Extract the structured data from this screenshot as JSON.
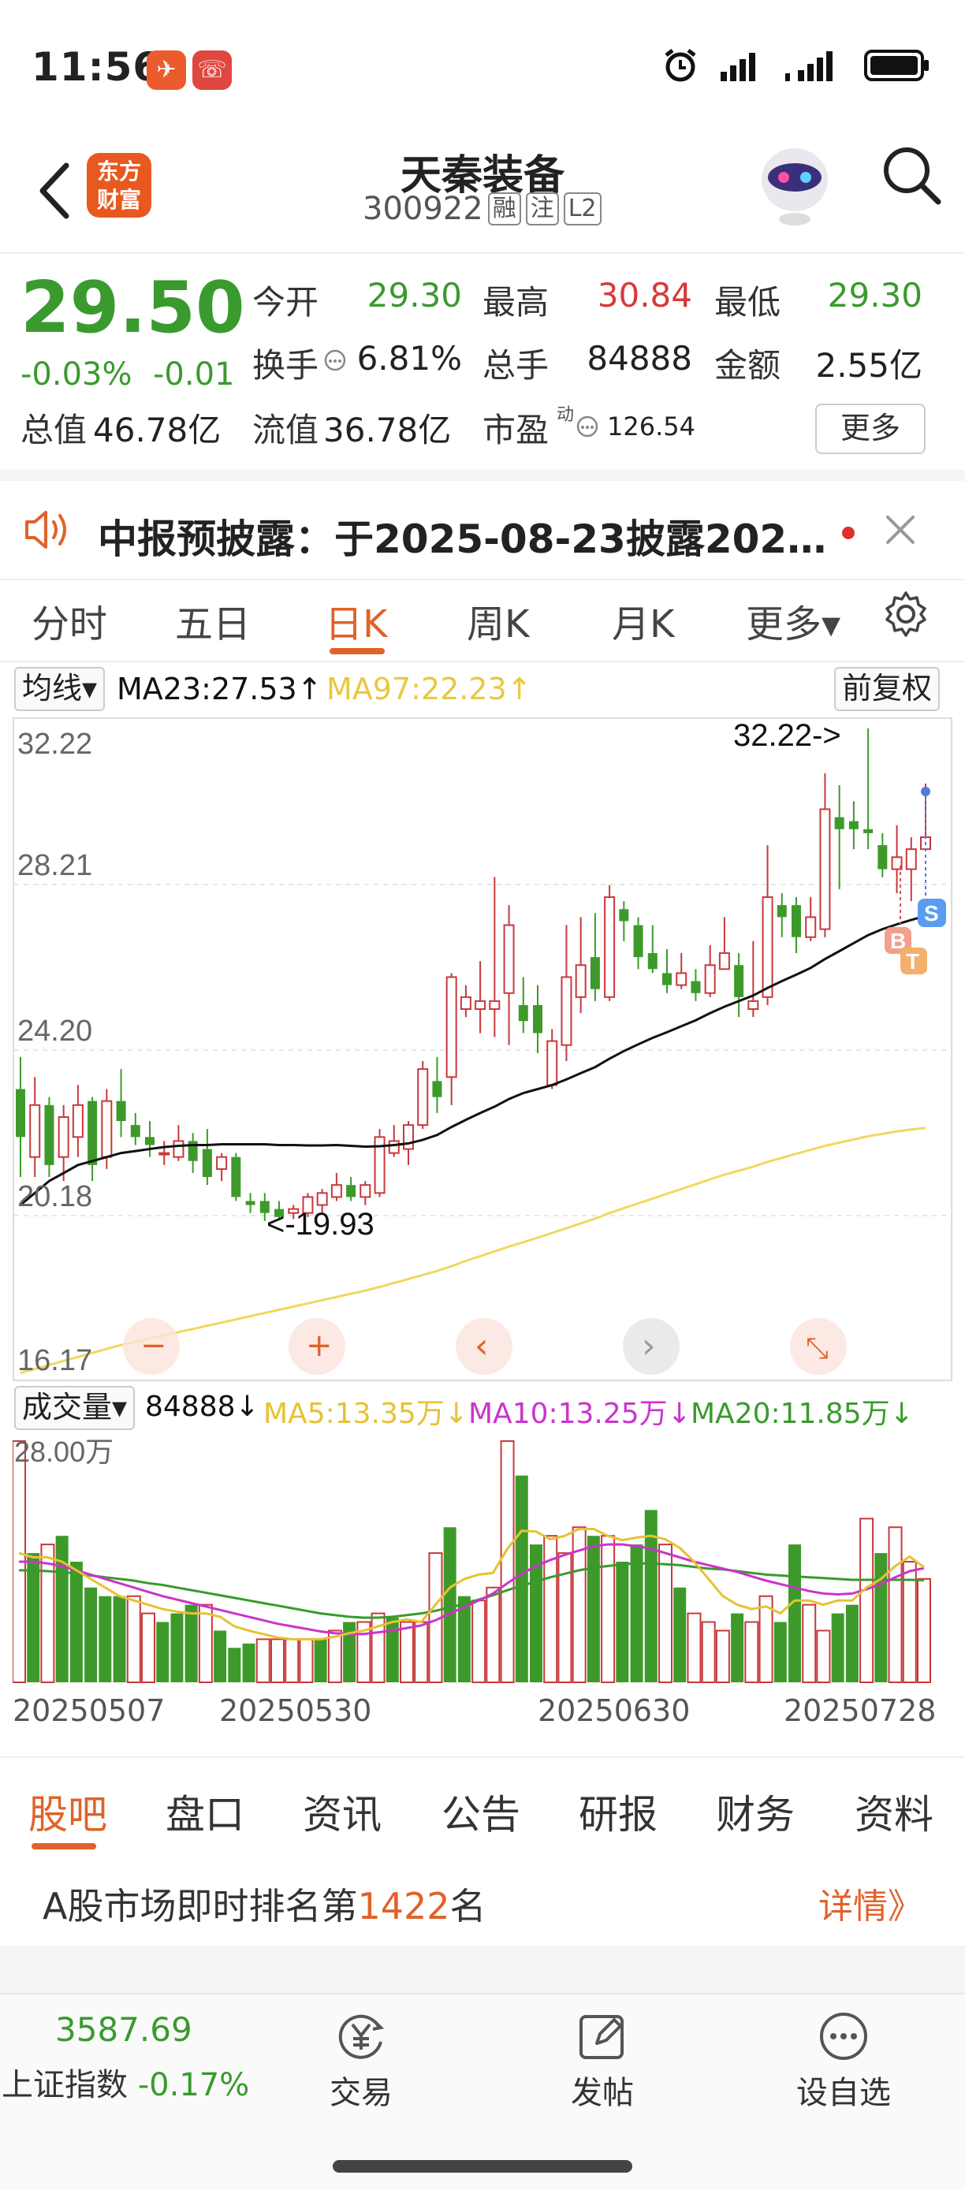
{
  "status_bar": {
    "time": "11:56",
    "app_badge_1": "✈",
    "app_badge_2": "☏"
  },
  "header": {
    "brand_line1": "东方",
    "brand_line2": "财富",
    "stock_name": "天秦装备",
    "stock_code": "300922",
    "tags": [
      "融",
      "注",
      "L2"
    ]
  },
  "quote": {
    "price": "29.50",
    "change_pct": "-0.03%",
    "change_amt": "-0.01",
    "open_label": "今开",
    "open": "29.30",
    "high_label": "最高",
    "high": "30.84",
    "low_label": "最低",
    "low": "29.30",
    "turnover_label": "换手",
    "turnover": "6.81%",
    "volume_label": "总手",
    "volume": "84888",
    "amount_label": "金额",
    "amount": "2.55亿",
    "mktcap_label": "总值",
    "mktcap": "46.78亿",
    "float_label": "流值",
    "float_cap": "36.78亿",
    "pe_label": "市盈",
    "pe_sup": "动",
    "pe": "126.54",
    "more": "更多"
  },
  "notice": {
    "text": "中报预披露：于2025-08-23披露202…"
  },
  "kline_tabs": {
    "items": [
      "分时",
      "五日",
      "日K",
      "周K",
      "月K",
      "更多▾"
    ],
    "active": "日K"
  },
  "ma_row": {
    "selector": "均线▾",
    "ma23": "MA23:27.53↑",
    "ma97": "MA97:22.23↑",
    "adjust": "前复权"
  },
  "chart_data": {
    "type": "candlestick",
    "y_axis_labels": [
      "32.22",
      "28.21",
      "24.20",
      "20.18",
      "16.17"
    ],
    "ylim": [
      16.17,
      32.22
    ],
    "max_label": "32.22->",
    "min_label": "<-19.93",
    "markers": [
      "B",
      "T",
      "S"
    ],
    "candles": [
      [
        23.2,
        22.0,
        24.0,
        21.0
      ],
      [
        21.5,
        22.8,
        23.5,
        21.0
      ],
      [
        22.8,
        21.3,
        23.0,
        21.0
      ],
      [
        21.5,
        22.5,
        22.8,
        20.9
      ],
      [
        22.0,
        22.8,
        23.3,
        21.5
      ],
      [
        22.9,
        21.3,
        23.0,
        20.9
      ],
      [
        21.5,
        22.9,
        23.2,
        21.2
      ],
      [
        22.9,
        22.4,
        23.7,
        22.0
      ],
      [
        22.3,
        22.0,
        22.6,
        21.8
      ],
      [
        22.0,
        21.8,
        22.4,
        21.5
      ],
      [
        21.6,
        21.6,
        21.9,
        21.3
      ],
      [
        21.5,
        21.9,
        22.3,
        21.4
      ],
      [
        21.9,
        21.4,
        22.1,
        21.1
      ],
      [
        21.7,
        21.0,
        22.2,
        20.8
      ],
      [
        21.2,
        21.5,
        21.6,
        20.9
      ],
      [
        21.5,
        20.5,
        21.6,
        20.4
      ],
      [
        20.4,
        20.3,
        20.6,
        20.1
      ],
      [
        20.4,
        20.1,
        20.6,
        19.9
      ],
      [
        20.2,
        20.0,
        20.4,
        19.93
      ],
      [
        20.1,
        20.2,
        20.3,
        19.95
      ],
      [
        20.1,
        20.5,
        20.6,
        20.0
      ],
      [
        20.3,
        20.6,
        20.7,
        20.1
      ],
      [
        20.5,
        20.8,
        21.1,
        20.4
      ],
      [
        20.8,
        20.5,
        21.0,
        20.4
      ],
      [
        20.5,
        20.8,
        20.9,
        20.3
      ],
      [
        20.6,
        22.0,
        22.2,
        20.5
      ],
      [
        21.6,
        21.9,
        22.3,
        21.5
      ],
      [
        21.7,
        22.3,
        22.4,
        21.3
      ],
      [
        22.3,
        23.7,
        23.9,
        22.2
      ],
      [
        23.4,
        23.0,
        24.0,
        22.6
      ],
      [
        23.5,
        26.0,
        26.1,
        22.8
      ],
      [
        25.2,
        25.5,
        25.8,
        25.0
      ],
      [
        25.2,
        25.4,
        26.4,
        24.6
      ],
      [
        25.2,
        25.4,
        28.5,
        24.5
      ],
      [
        25.6,
        27.3,
        27.8,
        24.3
      ],
      [
        25.3,
        24.9,
        26.0,
        24.6
      ],
      [
        25.3,
        24.6,
        25.8,
        24.1
      ],
      [
        23.3,
        24.4,
        24.7,
        23.2
      ],
      [
        24.3,
        26.0,
        27.3,
        23.9
      ],
      [
        25.5,
        26.3,
        27.5,
        25.1
      ],
      [
        26.5,
        25.7,
        27.6,
        25.4
      ],
      [
        25.5,
        28.0,
        28.3,
        25.4
      ],
      [
        27.7,
        27.4,
        27.9,
        26.9
      ],
      [
        27.3,
        26.5,
        27.5,
        26.2
      ],
      [
        26.6,
        26.2,
        27.3,
        26.1
      ],
      [
        26.1,
        25.8,
        26.7,
        25.6
      ],
      [
        25.8,
        26.1,
        26.6,
        25.7
      ],
      [
        25.9,
        25.6,
        26.2,
        25.4
      ],
      [
        25.6,
        26.3,
        26.8,
        25.5
      ],
      [
        26.2,
        26.6,
        27.5,
        26.2
      ],
      [
        26.3,
        25.5,
        26.6,
        25.0
      ],
      [
        25.2,
        25.4,
        26.9,
        25.0
      ],
      [
        25.5,
        28.0,
        29.3,
        25.3
      ],
      [
        27.8,
        27.5,
        28.1,
        27.0
      ],
      [
        27.8,
        27.0,
        28.0,
        26.6
      ],
      [
        27.0,
        27.5,
        28.0,
        26.9
      ],
      [
        27.2,
        30.2,
        31.1,
        27.0
      ],
      [
        30.0,
        29.7,
        30.8,
        28.2
      ],
      [
        29.9,
        29.7,
        30.4,
        29.2
      ],
      [
        29.7,
        29.6,
        32.22,
        29.2
      ],
      [
        29.3,
        28.7,
        29.6,
        28.5
      ],
      [
        28.7,
        29.0,
        29.8,
        28.1
      ],
      [
        28.7,
        29.2,
        29.5,
        27.9
      ],
      [
        29.2,
        29.5,
        30.84,
        29.3
      ]
    ],
    "ma23": [
      20.3,
      20.6,
      20.9,
      21.1,
      21.3,
      21.4,
      21.5,
      21.6,
      21.65,
      21.7,
      21.75,
      21.78,
      21.8,
      21.8,
      21.82,
      21.82,
      21.82,
      21.82,
      21.8,
      21.8,
      21.79,
      21.79,
      21.8,
      21.78,
      21.76,
      21.77,
      21.8,
      21.84,
      21.93,
      22.05,
      22.25,
      22.43,
      22.6,
      22.76,
      22.95,
      23.1,
      23.2,
      23.3,
      23.44,
      23.6,
      23.75,
      23.96,
      24.15,
      24.32,
      24.48,
      24.62,
      24.77,
      24.92,
      25.1,
      25.26,
      25.4,
      25.54,
      25.73,
      25.9,
      26.06,
      26.23,
      26.45,
      26.65,
      26.85,
      27.05,
      27.2,
      27.32,
      27.43,
      27.53
    ],
    "ma97": [
      16.1,
      16.2,
      16.3,
      16.4,
      16.5,
      16.6,
      16.7,
      16.8,
      16.88,
      16.96,
      17.04,
      17.12,
      17.2,
      17.28,
      17.36,
      17.44,
      17.52,
      17.6,
      17.68,
      17.76,
      17.84,
      17.92,
      18.0,
      18.08,
      18.16,
      18.25,
      18.35,
      18.45,
      18.55,
      18.65,
      18.77,
      18.9,
      19.02,
      19.14,
      19.26,
      19.37,
      19.48,
      19.6,
      19.72,
      19.84,
      19.96,
      20.1,
      20.22,
      20.34,
      20.46,
      20.58,
      20.7,
      20.82,
      20.94,
      21.06,
      21.16,
      21.26,
      21.38,
      21.48,
      21.58,
      21.68,
      21.78,
      21.86,
      21.94,
      22.02,
      22.08,
      22.14,
      22.19,
      22.23
    ]
  },
  "chart_controls": [
    "−",
    "+",
    "‹",
    "›",
    "⤡"
  ],
  "vol_row": {
    "selector": "成交量▾",
    "vol": "84888↓",
    "ma5": "MA5:13.35万↓",
    "ma10": "MA10:13.25万↓",
    "ma20": "MA20:11.85万↓",
    "scale": "28.00万"
  },
  "volume_data": {
    "values": [
      28,
      15,
      16,
      17,
      14,
      11,
      10,
      10,
      10,
      8,
      7,
      8,
      9,
      9,
      6,
      4,
      4.5,
      5,
      5,
      5,
      5,
      5,
      6,
      7,
      7,
      8,
      7.5,
      7,
      7,
      15,
      18,
      10,
      9.5,
      11,
      28,
      24,
      16,
      17,
      15,
      18,
      17,
      17,
      14,
      16,
      20,
      16,
      11,
      8,
      7,
      6,
      8,
      7,
      10,
      7,
      16,
      9,
      6,
      8,
      9,
      19,
      15,
      18,
      14,
      12
    ],
    "up": [
      1,
      0,
      1,
      0,
      0,
      0,
      0,
      0,
      1,
      1,
      0,
      0,
      0,
      1,
      0,
      0,
      0,
      1,
      1,
      1,
      1,
      0,
      1,
      0,
      1,
      1,
      0,
      1,
      1,
      1,
      0,
      0,
      1,
      1,
      1,
      0,
      0,
      1,
      1,
      1,
      0,
      1,
      0,
      0,
      0,
      1,
      0,
      1,
      1,
      1,
      0,
      1,
      1,
      0,
      0,
      1,
      1,
      0,
      0,
      1,
      0,
      1,
      1,
      1
    ],
    "ma5": [
      15,
      14.5,
      14.5,
      14,
      13,
      12,
      11,
      10,
      9.5,
      9,
      8.5,
      8.2,
      8,
      8,
      7.6,
      6.5,
      6,
      5.6,
      5.2,
      5,
      5,
      5,
      5.3,
      5.7,
      6,
      6.5,
      7,
      7.3,
      7,
      9,
      11,
      12,
      12.5,
      12.7,
      15.5,
      17.6,
      17.5,
      16.6,
      17,
      17.8,
      17.8,
      17,
      16.5,
      16.8,
      17,
      16.6,
      15.6,
      14,
      12,
      10,
      9,
      8.5,
      8.8,
      8,
      9.5,
      9.5,
      9,
      9.5,
      9.5,
      11,
      12,
      13.5,
      14.6,
      13.35
    ],
    "ma10": [
      14,
      14,
      13.8,
      13.5,
      13,
      12.5,
      12,
      11.5,
      11,
      10.5,
      10,
      9.6,
      9.2,
      8.8,
      8.4,
      8,
      7.6,
      7.2,
      6.8,
      6.5,
      6.2,
      5.9,
      5.7,
      5.6,
      5.6,
      5.8,
      6,
      6.3,
      6.6,
      7.2,
      8,
      8.7,
      9.5,
      10.3,
      11.5,
      12.6,
      13.5,
      14.2,
      14.8,
      15.3,
      15.8,
      16,
      16,
      15.8,
      15.5,
      15,
      14.5,
      14,
      13.6,
      13.2,
      12.8,
      12.3,
      11.8,
      11.4,
      11,
      10.6,
      10.3,
      10.2,
      10.3,
      10.8,
      11.4,
      12.2,
      12.9,
      13.25
    ],
    "ma20": [
      13,
      13,
      12.9,
      12.8,
      12.6,
      12.4,
      12.2,
      12,
      11.8,
      11.5,
      11.3,
      11,
      10.7,
      10.4,
      10.1,
      9.8,
      9.5,
      9.2,
      8.9,
      8.6,
      8.3,
      8,
      7.8,
      7.6,
      7.5,
      7.5,
      7.6,
      7.8,
      8,
      8.3,
      8.7,
      9.1,
      9.6,
      10.1,
      10.7,
      11.2,
      11.7,
      12.2,
      12.6,
      13,
      13.3,
      13.5,
      13.7,
      13.8,
      13.8,
      13.7,
      13.6,
      13.4,
      13.2,
      13.1,
      12.9,
      12.7,
      12.5,
      12.4,
      12.3,
      12.2,
      12.1,
      12,
      11.9,
      11.9,
      11.9,
      11.9,
      11.9,
      11.85
    ],
    "max": 28.0
  },
  "vol_dates": [
    "20250507",
    "20250530",
    "20250630",
    "20250728"
  ],
  "sub_tabs": {
    "items": [
      "股吧",
      "盘口",
      "资讯",
      "公告",
      "研报",
      "财务",
      "资料"
    ],
    "active": "股吧"
  },
  "rank": {
    "prefix": "A股市场即时排名第",
    "number": "1422",
    "suffix": "名",
    "detail": "详情》"
  },
  "bottom_nav": {
    "index_value": "3587.69",
    "index_name": "上证指数",
    "index_change": "-0.17%",
    "trade": "交易",
    "post": "发帖",
    "watch": "设自选"
  },
  "colors": {
    "up": "#c8383a",
    "down": "#3d9a2a",
    "accent": "#e0622a",
    "ma23": "#111111",
    "ma97": "#f0d860",
    "ma5": "#e6c233",
    "ma10": "#cc33cc",
    "ma20": "#3a9a2e"
  }
}
